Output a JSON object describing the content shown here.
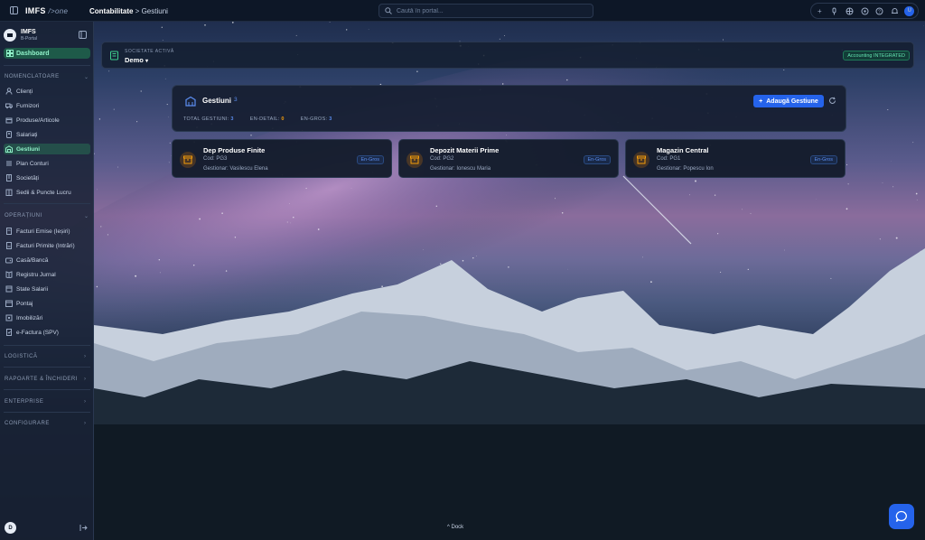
{
  "topbar": {
    "brand": "IMFS",
    "brand_suffix": "/>one",
    "breadcrumb_section": "Contabilitate",
    "breadcrumb_page": "Gestiuni",
    "search_placeholder": "Caută în portal...",
    "user_initial": "U"
  },
  "sidebar": {
    "org_name": "IMFS",
    "org_sub": "B-Portal",
    "dashboard_label": "Dashboard",
    "sections": {
      "nomenclatoare": "NOMENCLATOARE",
      "operatiuni": "OPERAȚIUNI",
      "logistica": "LOGISTICĂ",
      "rapoarte": "RAPOARTE & ÎNCHIDERI",
      "enterprise": "ENTERPRISE",
      "configurare": "CONFIGURARE"
    },
    "nomenclatoare_items": [
      {
        "label": "Clienți",
        "icon": "users-icon"
      },
      {
        "label": "Furnizori",
        "icon": "truck-icon"
      },
      {
        "label": "Produse/Articole",
        "icon": "box-icon"
      },
      {
        "label": "Salariați",
        "icon": "user-icon"
      },
      {
        "label": "Gestiuni",
        "icon": "warehouse-icon"
      },
      {
        "label": "Plan Conturi",
        "icon": "list-icon"
      },
      {
        "label": "Societăți",
        "icon": "building-icon"
      },
      {
        "label": "Sedii & Puncte Lucru",
        "icon": "location-icon"
      }
    ],
    "operatiuni_items": [
      {
        "label": "Facturi Emise (Ieșiri)",
        "icon": "invoice-out-icon"
      },
      {
        "label": "Facturi Primite (Intrări)",
        "icon": "invoice-in-icon"
      },
      {
        "label": "Casă/Bancă",
        "icon": "wallet-icon"
      },
      {
        "label": "Registru Jurnal",
        "icon": "book-icon"
      },
      {
        "label": "State Salarii",
        "icon": "payroll-icon"
      },
      {
        "label": "Pontaj",
        "icon": "clock-icon"
      },
      {
        "label": "Imobilizări",
        "icon": "asset-icon"
      },
      {
        "label": "e-Factura (SPV)",
        "icon": "cloud-icon"
      }
    ],
    "footer_initial": "D"
  },
  "company_bar": {
    "label": "SOCIETATE ACTIVĂ",
    "value": "Demo",
    "badge": "Accounting INTEGRATED"
  },
  "gestiuni": {
    "title": "Gestiuni",
    "count": "3",
    "stats": [
      {
        "label": "TOTAL GESTIUNI",
        "value": "3",
        "color": "#5b8def"
      },
      {
        "label": "EN-DETAIL",
        "value": "0",
        "color": "#f59e0b"
      },
      {
        "label": "EN-GROS",
        "value": "3",
        "color": "#5b8def"
      }
    ],
    "add_button": "Adaugă Gestiune",
    "cards": [
      {
        "name": "Dep Produse Finite",
        "code": "Cod: PG3",
        "manager": "Gestionar: Vasilescu Elena",
        "tag": "En-Gros"
      },
      {
        "name": "Depozit Materii Prime",
        "code": "Cod: PG2",
        "manager": "Gestionar: Ionescu Maria",
        "tag": "En-Gros"
      },
      {
        "name": "Magazin Central",
        "code": "Cod: PG1",
        "manager": "Gestionar: Popescu Ion",
        "tag": "En-Gros"
      }
    ]
  },
  "dock_label": "Dock",
  "colors": {
    "accent": "#2563eb",
    "active": "#3ecf8e",
    "warning": "#f59e0b"
  }
}
